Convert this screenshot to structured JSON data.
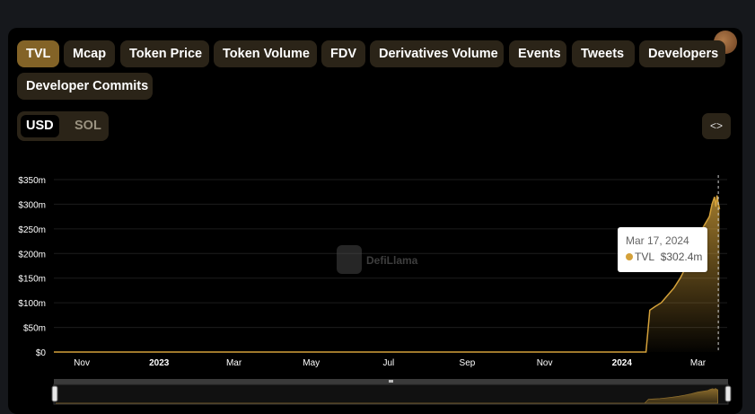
{
  "tabs": [
    "TVL",
    "Mcap",
    "Token Price",
    "Token Volume",
    "FDV",
    "Derivatives Volume",
    "Events",
    "Tweets",
    "Developers",
    "Developer Commits"
  ],
  "active_tab": "TVL",
  "currency_toggle": {
    "options": [
      "USD",
      "SOL"
    ],
    "selected": "USD"
  },
  "embed_button": {
    "icon": "code-brackets-icon"
  },
  "watermark": "DefiLlama",
  "tooltip": {
    "date": "Mar 17, 2024",
    "series": "TVL",
    "value": "$302.4m"
  },
  "colors": {
    "accent": "#d4a13a",
    "active_tab": "#836327",
    "tab_bg": "#2b2418"
  },
  "chart_data": {
    "type": "area",
    "title": "",
    "xlabel": "",
    "ylabel": "",
    "y_tick_labels": [
      "$0",
      "$50m",
      "$100m",
      "$150m",
      "$200m",
      "$250m",
      "$300m",
      "$350m"
    ],
    "ylim": [
      0,
      350
    ],
    "y_unit": "$m",
    "x_tick_labels": [
      "Nov",
      "2023",
      "Mar",
      "May",
      "Jul",
      "Sep",
      "Nov",
      "2024",
      "Mar"
    ],
    "x_ticks": [
      "2022-11-01",
      "2023-01-01",
      "2023-03-01",
      "2023-05-01",
      "2023-07-01",
      "2023-09-01",
      "2023-11-01",
      "2024-01-01",
      "2024-03-01"
    ],
    "xlim": [
      "2022-10-10",
      "2024-03-24"
    ],
    "grid": true,
    "series": [
      {
        "name": "TVL",
        "color": "#d4a13a",
        "points": [
          [
            "2022-10-10",
            0
          ],
          [
            "2024-01-20",
            0
          ],
          [
            "2024-01-23",
            85
          ],
          [
            "2024-01-27",
            92
          ],
          [
            "2024-02-01",
            100
          ],
          [
            "2024-02-06",
            115
          ],
          [
            "2024-02-11",
            130
          ],
          [
            "2024-02-16",
            150
          ],
          [
            "2024-02-21",
            175
          ],
          [
            "2024-02-26",
            205
          ],
          [
            "2024-03-02",
            240
          ],
          [
            "2024-03-07",
            262
          ],
          [
            "2024-03-10",
            275
          ],
          [
            "2024-03-12",
            300
          ],
          [
            "2024-03-14",
            315
          ],
          [
            "2024-03-15",
            295
          ],
          [
            "2024-03-16",
            318
          ],
          [
            "2024-03-17",
            302.4
          ],
          [
            "2024-03-18",
            290
          ]
        ]
      }
    ]
  }
}
